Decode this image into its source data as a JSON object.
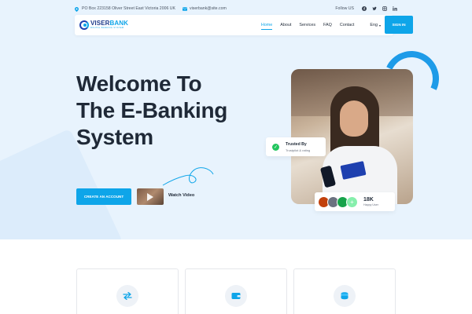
{
  "topbar": {
    "address": "PO Box 223158 Oliver Street East Victoria 2006 UK",
    "email": "viserbank@site.com",
    "follow_label": "Follow US",
    "social_icons": [
      "facebook-icon",
      "twitter-icon",
      "instagram-icon",
      "linkedin-icon"
    ]
  },
  "brand": {
    "name_part1": "VISER",
    "name_part2": "BANK",
    "tagline": "DIGITAL BANKING SYSTEM"
  },
  "nav": {
    "items": [
      {
        "label": "Home",
        "active": true
      },
      {
        "label": "About",
        "active": false
      },
      {
        "label": "Services",
        "active": false
      },
      {
        "label": "FAQ",
        "active": false
      },
      {
        "label": "Contact",
        "active": false
      }
    ],
    "language": "Eng",
    "signin_label": "SIGN IN"
  },
  "hero": {
    "headline_lines": [
      "Welcome To",
      "The E-Banking",
      "System"
    ],
    "cta_label": "CREATE AN ACCOUNT",
    "video_label": "Watch Video",
    "trusted_title": "Trusted By",
    "trusted_sub": "Trustpilot & rating",
    "users_count": "18K",
    "users_label": "Happy User"
  },
  "features": {
    "icons": [
      "exchange-icon",
      "wallet-icon",
      "coins-icon"
    ]
  },
  "colors": {
    "accent": "#0ea5e9",
    "hero_bg": "#e8f3fd",
    "brand_dark": "#1e3a8a"
  }
}
